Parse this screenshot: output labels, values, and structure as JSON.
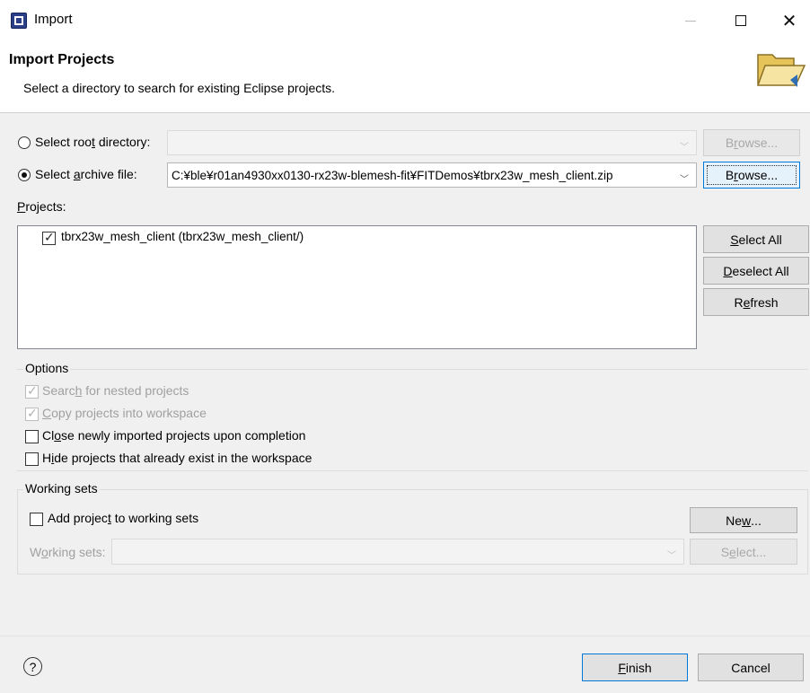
{
  "window": {
    "title": "Import",
    "app_icon": "eclipse-import-icon",
    "controls": {
      "minimize": "minimize-icon",
      "maximize": "maximize-icon",
      "close": "close-icon"
    }
  },
  "header": {
    "title": "Import Projects",
    "description": "Select a directory to search for existing Eclipse projects.",
    "icon": "folder-icon"
  },
  "source": {
    "root_directory": {
      "label_pre": "Select roo",
      "label_accel": "t",
      "label_post": " directory:",
      "selected": false,
      "value": "",
      "enabled": false
    },
    "archive_file": {
      "label_pre": "Select ",
      "label_accel": "a",
      "label_post": "rchive file:",
      "selected": true,
      "value": "C:¥ble¥r01an4930xx0130-rx23w-blemesh-fit¥FITDemos¥tbrx23w_mesh_client.zip"
    },
    "browse_root": {
      "pre": "B",
      "accel": "r",
      "post": "owse...",
      "enabled": false
    },
    "browse_archive": {
      "pre": "B",
      "accel": "r",
      "post": "owse...",
      "enabled": true
    }
  },
  "projects": {
    "label_accel": "P",
    "label_post": "rojects:",
    "items": [
      {
        "label": "tbrx23w_mesh_client (tbrx23w_mesh_client/)",
        "checked": true
      }
    ],
    "buttons": {
      "select_all": {
        "accel": "S",
        "post": "elect All"
      },
      "deselect_all": {
        "accel": "D",
        "post": "eselect All"
      },
      "refresh": {
        "pre": "R",
        "accel": "e",
        "post": "fresh"
      }
    }
  },
  "options": {
    "title": "Options",
    "items": [
      {
        "pre": "Searc",
        "accel": "h",
        "post": " for nested projects",
        "checked": true,
        "enabled": false
      },
      {
        "pre": "",
        "accel": "C",
        "post": "opy projects into workspace",
        "checked": true,
        "enabled": false
      },
      {
        "pre": "Cl",
        "accel": "o",
        "post": "se newly imported projects upon completion",
        "checked": false,
        "enabled": true
      },
      {
        "pre": "H",
        "accel": "i",
        "post": "de projects that already exist in the workspace",
        "checked": false,
        "enabled": true
      }
    ]
  },
  "working_sets": {
    "title": "Working sets",
    "add_checkbox": {
      "pre": "Add projec",
      "accel": "t",
      "post": " to working sets",
      "checked": false
    },
    "label": {
      "pre": "W",
      "accel": "o",
      "post": "rking sets:"
    },
    "value": "",
    "new_button": {
      "pre": "Ne",
      "accel": "w",
      "post": "..."
    },
    "select_button": {
      "pre": "S",
      "accel": "e",
      "post": "lect...",
      "enabled": false
    }
  },
  "footer": {
    "help": "?",
    "finish": {
      "accel": "F",
      "post": "inish"
    },
    "cancel": "Cancel"
  }
}
